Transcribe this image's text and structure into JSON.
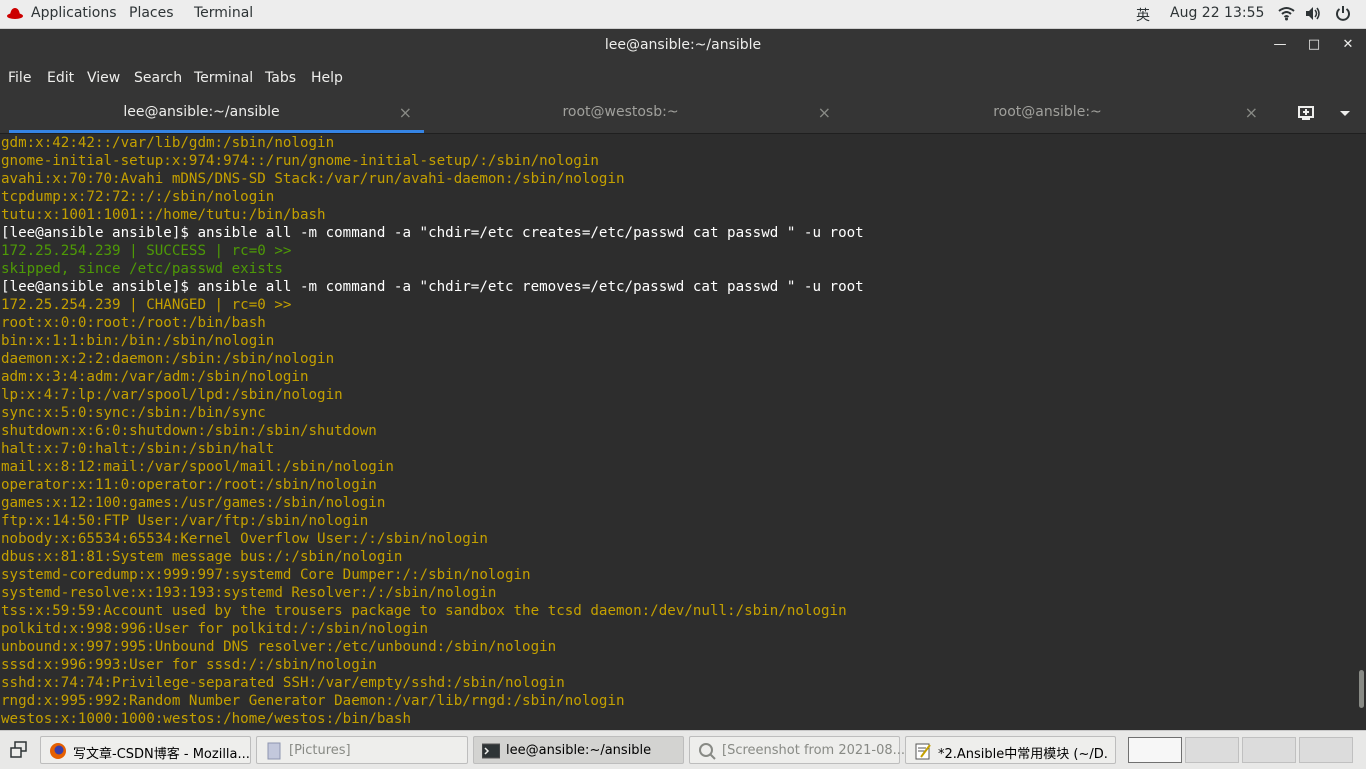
{
  "topbar": {
    "applications": "Applications",
    "places": "Places",
    "terminal": "Terminal",
    "input_method": "英",
    "clock": "Aug 22  13:55"
  },
  "window": {
    "title": "lee@ansible:~/ansible"
  },
  "menu": [
    "File",
    "Edit",
    "View",
    "Search",
    "Terminal",
    "Tabs",
    "Help"
  ],
  "tabs": [
    {
      "label": "lee@ansible:~/ansible"
    },
    {
      "label": "root@westosb:~"
    },
    {
      "label": "root@ansible:~"
    }
  ],
  "terminal_lines": [
    {
      "text": "gdm:x:42:42::/var/lib/gdm:/sbin/nologin",
      "color": "yellow"
    },
    {
      "text": "gnome-initial-setup:x:974:974::/run/gnome-initial-setup/:/sbin/nologin",
      "color": "yellow"
    },
    {
      "text": "avahi:x:70:70:Avahi mDNS/DNS-SD Stack:/var/run/avahi-daemon:/sbin/nologin",
      "color": "yellow"
    },
    {
      "text": "tcpdump:x:72:72::/:/sbin/nologin",
      "color": "yellow"
    },
    {
      "text": "tutu:x:1001:1001::/home/tutu:/bin/bash",
      "color": "yellow"
    },
    {
      "text": "[lee@ansible ansible]$ ansible all -m command -a \"chdir=/etc creates=/etc/passwd cat passwd \" -u root",
      "color": "white"
    },
    {
      "text": "172.25.254.239 | SUCCESS | rc=0 >>",
      "color": "green"
    },
    {
      "text": "skipped, since /etc/passwd exists",
      "color": "green"
    },
    {
      "text": "[lee@ansible ansible]$ ansible all -m command -a \"chdir=/etc removes=/etc/passwd cat passwd \" -u root",
      "color": "white"
    },
    {
      "text": "172.25.254.239 | CHANGED | rc=0 >>",
      "color": "yellow"
    },
    {
      "text": "root:x:0:0:root:/root:/bin/bash",
      "color": "yellow"
    },
    {
      "text": "bin:x:1:1:bin:/bin:/sbin/nologin",
      "color": "yellow"
    },
    {
      "text": "daemon:x:2:2:daemon:/sbin:/sbin/nologin",
      "color": "yellow"
    },
    {
      "text": "adm:x:3:4:adm:/var/adm:/sbin/nologin",
      "color": "yellow"
    },
    {
      "text": "lp:x:4:7:lp:/var/spool/lpd:/sbin/nologin",
      "color": "yellow"
    },
    {
      "text": "sync:x:5:0:sync:/sbin:/bin/sync",
      "color": "yellow"
    },
    {
      "text": "shutdown:x:6:0:shutdown:/sbin:/sbin/shutdown",
      "color": "yellow"
    },
    {
      "text": "halt:x:7:0:halt:/sbin:/sbin/halt",
      "color": "yellow"
    },
    {
      "text": "mail:x:8:12:mail:/var/spool/mail:/sbin/nologin",
      "color": "yellow"
    },
    {
      "text": "operator:x:11:0:operator:/root:/sbin/nologin",
      "color": "yellow"
    },
    {
      "text": "games:x:12:100:games:/usr/games:/sbin/nologin",
      "color": "yellow"
    },
    {
      "text": "ftp:x:14:50:FTP User:/var/ftp:/sbin/nologin",
      "color": "yellow"
    },
    {
      "text": "nobody:x:65534:65534:Kernel Overflow User:/:/sbin/nologin",
      "color": "yellow"
    },
    {
      "text": "dbus:x:81:81:System message bus:/:/sbin/nologin",
      "color": "yellow"
    },
    {
      "text": "systemd-coredump:x:999:997:systemd Core Dumper:/:/sbin/nologin",
      "color": "yellow"
    },
    {
      "text": "systemd-resolve:x:193:193:systemd Resolver:/:/sbin/nologin",
      "color": "yellow"
    },
    {
      "text": "tss:x:59:59:Account used by the trousers package to sandbox the tcsd daemon:/dev/null:/sbin/nologin",
      "color": "yellow"
    },
    {
      "text": "polkitd:x:998:996:User for polkitd:/:/sbin/nologin",
      "color": "yellow"
    },
    {
      "text": "unbound:x:997:995:Unbound DNS resolver:/etc/unbound:/sbin/nologin",
      "color": "yellow"
    },
    {
      "text": "sssd:x:996:993:User for sssd:/:/sbin/nologin",
      "color": "yellow"
    },
    {
      "text": "sshd:x:74:74:Privilege-separated SSH:/var/empty/sshd:/sbin/nologin",
      "color": "yellow"
    },
    {
      "text": "rngd:x:995:992:Random Number Generator Daemon:/var/lib/rngd:/sbin/nologin",
      "color": "yellow"
    },
    {
      "text": "westos:x:1000:1000:westos:/home/westos:/bin/bash",
      "color": "yellow"
    }
  ],
  "taskbar": {
    "items": [
      {
        "label": "写文章-CSDN博客 - Mozilla...",
        "icon": "firefox-icon"
      },
      {
        "label": "[Pictures]",
        "icon": "folder-icon"
      },
      {
        "label": "lee@ansible:~/ansible",
        "icon": "terminal-icon"
      },
      {
        "label": "[Screenshot from 2021-08...",
        "icon": "image-viewer-icon"
      },
      {
        "label": "*2.Ansible中常用模块 (~/D...",
        "icon": "text-editor-icon"
      }
    ]
  }
}
